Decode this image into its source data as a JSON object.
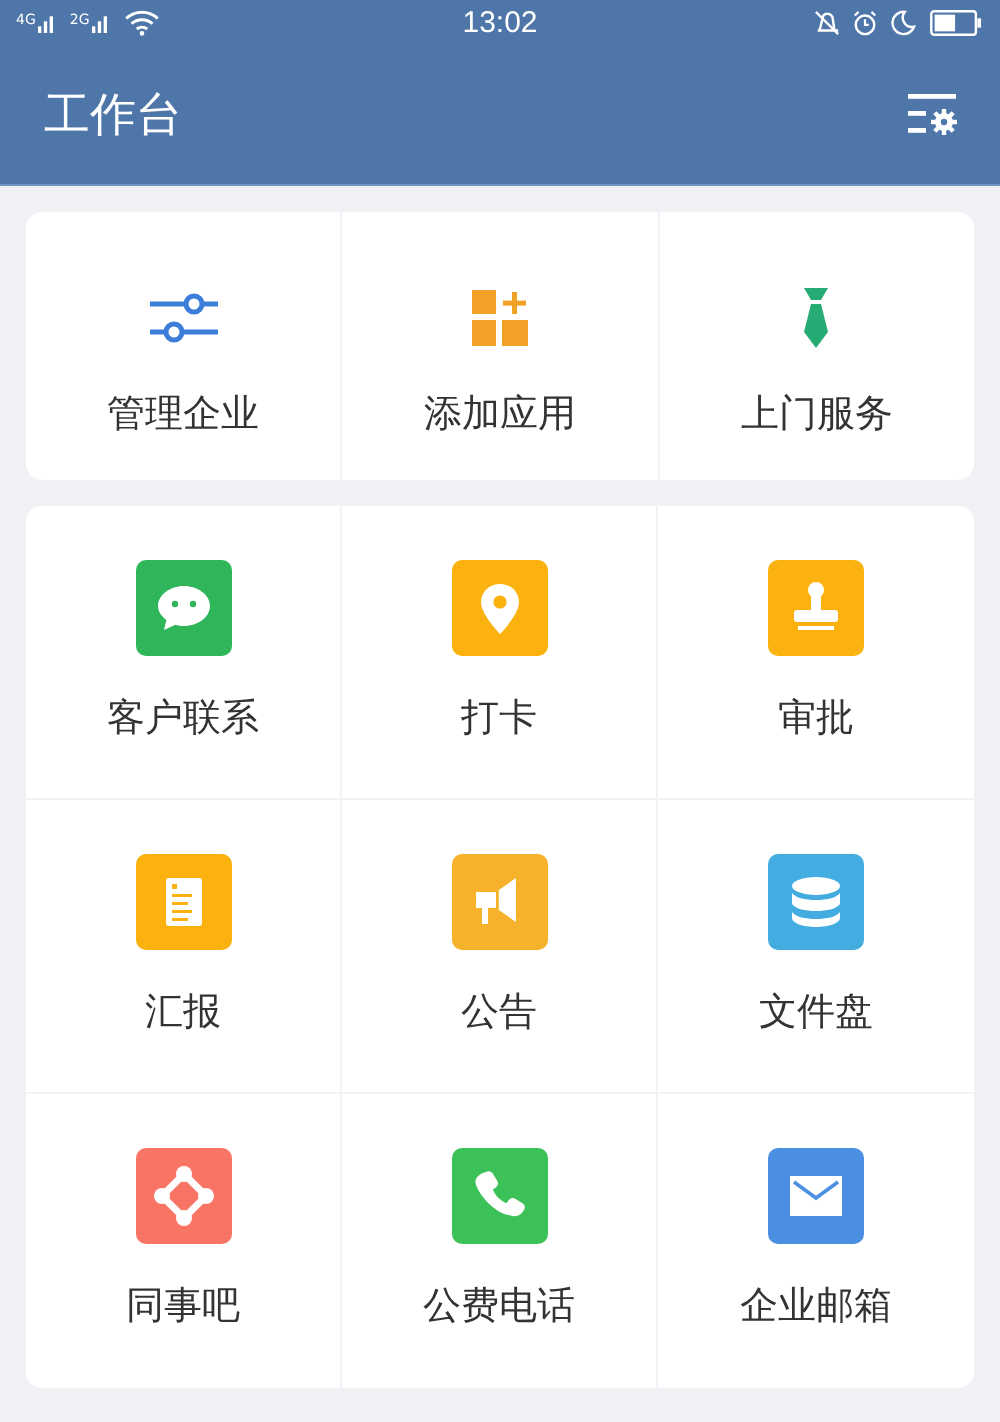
{
  "status_bar": {
    "networks": [
      "4G",
      "2G"
    ],
    "time": "13:02"
  },
  "header": {
    "title": "工作台"
  },
  "quick_actions": [
    {
      "label": "管理企业",
      "kind": "sliders",
      "color": "#3b7dd8"
    },
    {
      "label": "添加应用",
      "kind": "add-grid",
      "color": "#f0a126"
    },
    {
      "label": "上门服务",
      "kind": "tie",
      "color": "#27ab75"
    }
  ],
  "apps": [
    {
      "label": "客户联系",
      "kind": "chat",
      "color": "#2fb55a"
    },
    {
      "label": "打卡",
      "kind": "pin",
      "color": "#fbb20f"
    },
    {
      "label": "审批",
      "kind": "stamp",
      "color": "#fbb20f"
    },
    {
      "label": "汇报",
      "kind": "report",
      "color": "#fbb20f"
    },
    {
      "label": "公告",
      "kind": "megaphone",
      "color": "#f6b22a"
    },
    {
      "label": "文件盘",
      "kind": "database",
      "color": "#43ade2"
    },
    {
      "label": "同事吧",
      "kind": "network",
      "color": "#f87465"
    },
    {
      "label": "公费电话",
      "kind": "phone",
      "color": "#3cc158"
    },
    {
      "label": "企业邮箱",
      "kind": "mail",
      "color": "#4a8fe2"
    }
  ]
}
